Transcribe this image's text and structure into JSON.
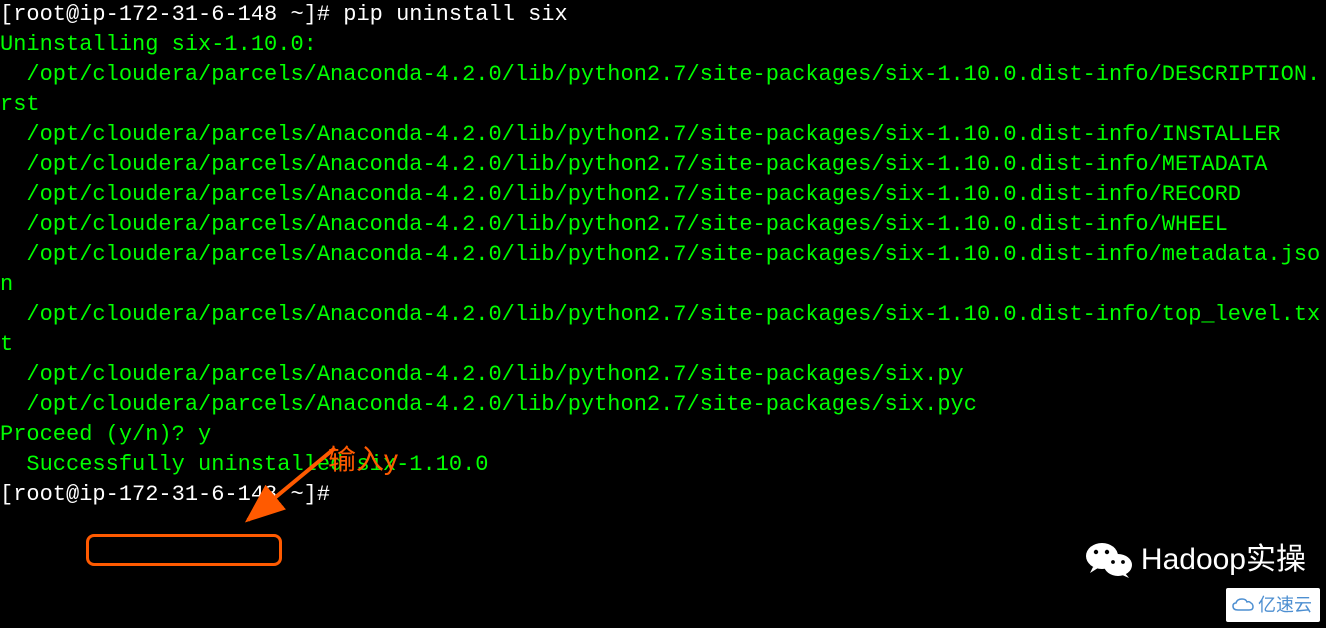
{
  "prompt1": {
    "prefix": "[root@ip-172-31-6-148 ~]# ",
    "command": "pip uninstall six"
  },
  "output": {
    "uninstalling": "Uninstalling six-1.10.0:",
    "files": [
      "  /opt/cloudera/parcels/Anaconda-4.2.0/lib/python2.7/site-packages/six-1.10.0.dist-info/DESCRIPTION.rst",
      "  /opt/cloudera/parcels/Anaconda-4.2.0/lib/python2.7/site-packages/six-1.10.0.dist-info/INSTALLER",
      "  /opt/cloudera/parcels/Anaconda-4.2.0/lib/python2.7/site-packages/six-1.10.0.dist-info/METADATA",
      "  /opt/cloudera/parcels/Anaconda-4.2.0/lib/python2.7/site-packages/six-1.10.0.dist-info/RECORD",
      "  /opt/cloudera/parcels/Anaconda-4.2.0/lib/python2.7/site-packages/six-1.10.0.dist-info/WHEEL",
      "  /opt/cloudera/parcels/Anaconda-4.2.0/lib/python2.7/site-packages/six-1.10.0.dist-info/metadata.json",
      "  /opt/cloudera/parcels/Anaconda-4.2.0/lib/python2.7/site-packages/six-1.10.0.dist-info/top_level.txt",
      "  /opt/cloudera/parcels/Anaconda-4.2.0/lib/python2.7/site-packages/six.py",
      "  /opt/cloudera/parcels/Anaconda-4.2.0/lib/python2.7/site-packages/six.pyc"
    ],
    "proceed_prompt": "Proceed (y/n)? ",
    "proceed_answer": "y",
    "success": "  Successfully uninstalled six-1.10.0"
  },
  "prompt2": {
    "prefix": "[root@ip-172-31-6-148 ~]# "
  },
  "annotation": {
    "text": "输入y"
  },
  "watermark": {
    "wechat_text": "Hadoop实操",
    "yisu_text": "亿速云"
  },
  "colors": {
    "terminal_green": "#00ff00",
    "prompt_white": "#ffffff",
    "annotation_orange": "#ff5a00",
    "background": "#000000"
  }
}
